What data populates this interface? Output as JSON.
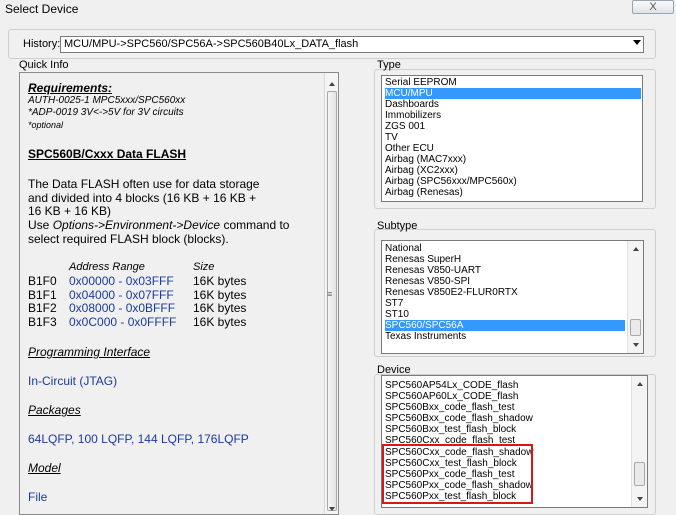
{
  "window": {
    "title": "Select Device",
    "close_glyph": "X"
  },
  "history": {
    "label": "History:",
    "value": "MCU/MPU->SPC560/SPC56A->SPC560B40Lx_DATA_flash"
  },
  "quick_info": {
    "label": "Quick Info",
    "requirements_heading": "Requirements:",
    "req_lines": [
      "AUTH-0025-1 MPC5xxx/SPC560xx",
      "*ADP-0019 3V<->5V for 3V circuits",
      "*optional"
    ],
    "device_heading": "SPC560B/Cxxx Data FLASH",
    "desc_lines": [
      "The Data FLASH often use for data storage",
      "and divided into 4 blocks (16 KB + 16 KB +",
      "16 KB + 16 KB)"
    ],
    "cmd_prefix": "Use ",
    "cmd_path": "Options->Environment->Device",
    "cmd_suffix": " command to",
    "cmd_line2": "select required FLASH block (blocks).",
    "table_headers": {
      "range": "Address Range",
      "size": "Size"
    },
    "blocks": [
      {
        "name": "B1F0",
        "range": "0x00000 - 0x03FFF",
        "size": "16K bytes"
      },
      {
        "name": "B1F1",
        "range": "0x04000 - 0x07FFF",
        "size": "16K bytes"
      },
      {
        "name": "B1F2",
        "range": "0x08000 - 0x0BFFF",
        "size": "16K bytes"
      },
      {
        "name": "B1F3",
        "range": "0x0C000 - 0x0FFFF",
        "size": "16K bytes"
      }
    ],
    "prog_if_heading": "Programming Interface",
    "prog_if_value": "In-Circuit (JTAG)",
    "packages_heading": "Packages",
    "packages_value": "64LQFP, 100 LQFP, 144 LQFP, 176LQFP",
    "model_heading": "Model",
    "model_value": "File"
  },
  "type_list": {
    "label": "Type",
    "items": [
      "Serial EEPROM",
      "MCU/MPU",
      "Dashboards",
      "Immobilizers",
      "ZGS 001",
      "TV",
      "Other ECU",
      "Airbag (MAC7xxx)",
      "Airbag (XC2xxx)",
      "Airbag (SPC56xxx/MPC560x)",
      "Airbag (Renesas)"
    ],
    "selected_index": 1
  },
  "subtype_list": {
    "label": "Subtype",
    "items": [
      "National",
      "Renesas SuperH",
      "Renesas V850-UART",
      "Renesas V850-SPI",
      "Renesas V850E2-FLUR0RTX",
      "ST7",
      "ST10",
      "SPC560/SPC56A",
      "Texas Instruments"
    ],
    "selected_index": 7
  },
  "device_list": {
    "label": "Device",
    "items": [
      "SPC560AP54Lx_CODE_flash",
      "SPC560AP60Lx_CODE_flash",
      "SPC560Bxx_code_flash_test",
      "SPC560Bxx_code_flash_shadow",
      "SPC560Bxx_test_flash_block",
      "SPC560Cxx_code_flash_test",
      "SPC560Cxx_code_flash_shadow",
      "SPC560Cxx_test_flash_block",
      "SPC560Pxx_code_flash_test",
      "SPC560Pxx_code_flash_shadow",
      "SPC560Pxx_test_flash_block"
    ],
    "highlight_color": "#d81818"
  },
  "colors": {
    "selection": "#3399ff",
    "link_blue": "#1a3a99"
  }
}
